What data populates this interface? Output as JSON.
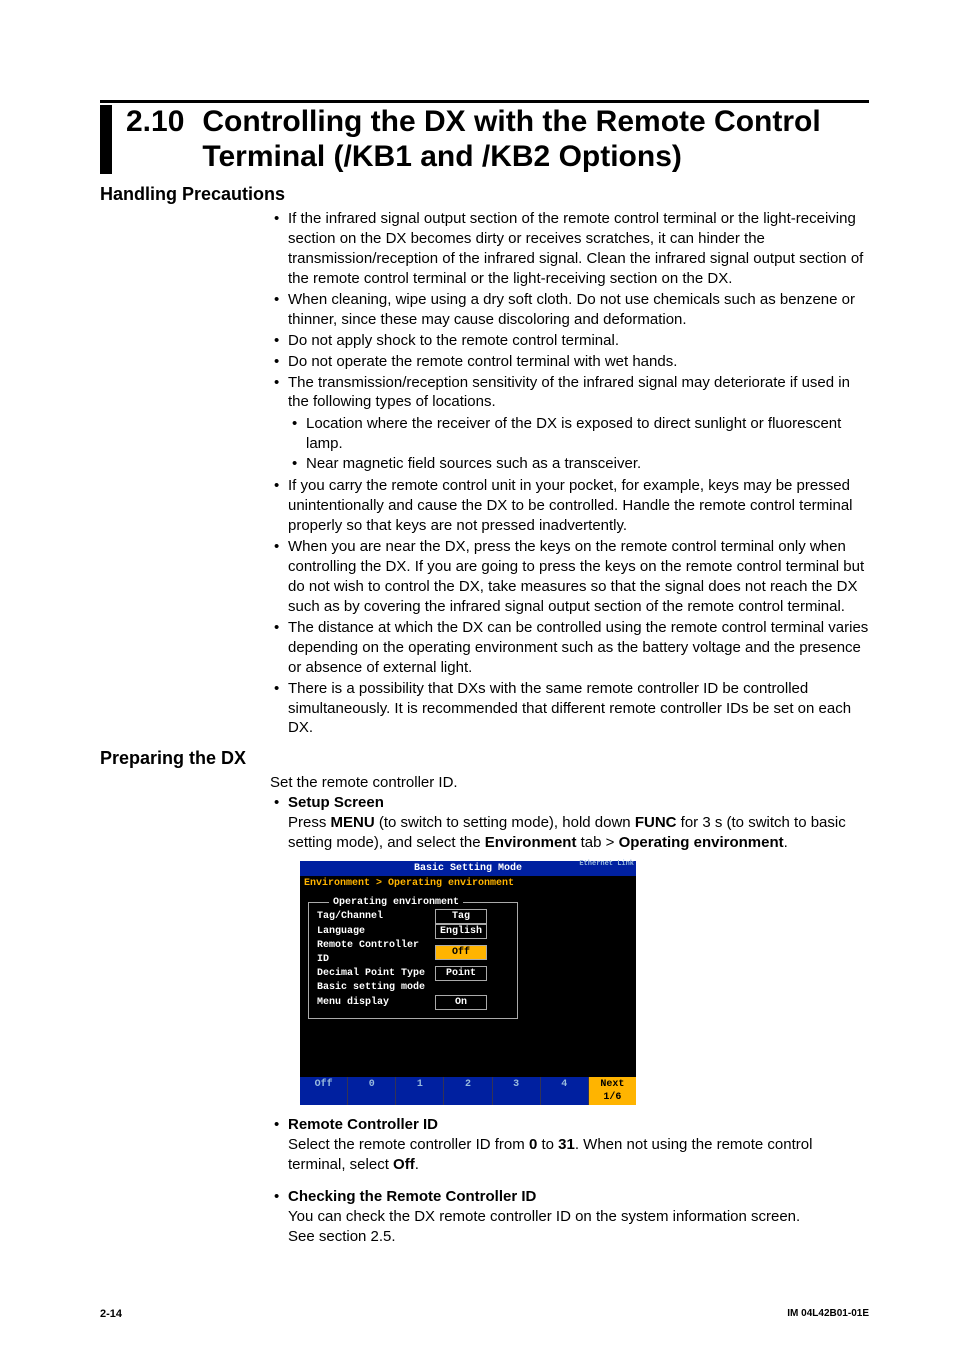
{
  "section_number": "2.10",
  "section_title": "Controlling the DX with the Remote Control Terminal (/KB1 and /KB2 Options)",
  "h1": "Handling Precautions",
  "bullets": [
    "If the infrared signal output section of the remote control terminal or the light-receiving section on the DX becomes dirty or receives scratches, it can hinder the transmission/reception of the infrared signal. Clean the infrared signal output section of the remote control terminal or the light-receiving section on the DX.",
    "When cleaning, wipe using a dry soft cloth. Do not use chemicals such as benzene or thinner, since these may cause discoloring and deformation.",
    "Do not apply shock to the remote control terminal.",
    "Do not operate the remote control terminal with wet hands.",
    "The transmission/reception sensitivity of the infrared signal may deteriorate if used in the following types of locations.",
    "If you carry the remote control unit in your pocket, for example, keys may be pressed unintentionally and cause the DX to be controlled. Handle the remote control terminal properly so that keys are not pressed inadvertently.",
    "When you are near the DX, press the keys on the remote control terminal only when controlling the DX. If you are going to press the keys on the remote control terminal but do not wish to control the DX, take measures so that the signal does not reach the DX such as by covering the infrared signal output section of the remote control terminal.",
    "The distance at which the DX can be controlled using the remote control terminal varies depending on the operating environment such as the battery voltage and the presence or absence of external light.",
    "There is a possibility that DXs with the same remote controller ID be controlled simultaneously. It is recommended that different remote controller IDs be set on each DX."
  ],
  "sub_bullets": [
    "Location where the receiver of the DX is exposed to direct sunlight or fluorescent lamp.",
    "Near magnetic field sources such as a transceiver."
  ],
  "h2": "Preparing the DX",
  "prep_intro": "Set the remote controller ID.",
  "setup_hdr": "Setup Screen",
  "setup_line_pre": "Press ",
  "setup_menu": "MENU",
  "setup_line_mid1": " (to switch to setting mode), hold down ",
  "setup_func": "FUNC",
  "setup_line_mid2": " for 3 s (to switch to basic setting mode), and select the ",
  "setup_env": "Environment",
  "setup_line_mid3": " tab > ",
  "setup_openv": "Operating environment",
  "setup_line_end": ".",
  "scr": {
    "title": "Basic Setting Mode",
    "link": "Ethernet Link",
    "breadcrumb": "Environment > Operating environment",
    "group_title": "Operating environment",
    "rows": [
      {
        "label": "Tag/Channel",
        "value": "Tag",
        "box": true
      },
      {
        "label": "Language",
        "value": "English",
        "box": true
      },
      {
        "label": "Remote Controller ID",
        "value": "Off",
        "hl": true
      },
      {
        "label": "Decimal Point Type",
        "value": "Point",
        "box": true
      },
      {
        "label": "Basic setting mode",
        "value": "",
        "nobox": true
      },
      {
        "label": " Menu display",
        "value": "On",
        "box": true
      }
    ],
    "footer": [
      "Off",
      "0",
      "1",
      "2",
      "3",
      "4",
      "Next 1/6"
    ]
  },
  "rc_hdr": "Remote Controller ID",
  "rc_line_pre": "Select the remote controller ID from ",
  "rc_0": "0",
  "rc_line_mid1": " to ",
  "rc_31": "31",
  "rc_line_mid2": ". When not using the remote control terminal, select ",
  "rc_off": "Off",
  "rc_line_end": ".",
  "chk_hdr": "Checking the Remote Controller ID",
  "chk_line1": "You can check the DX remote controller ID on the system information screen.",
  "chk_line2": "See section 2.5.",
  "page_num": "2-14",
  "doc_id": "IM 04L42B01-01E"
}
